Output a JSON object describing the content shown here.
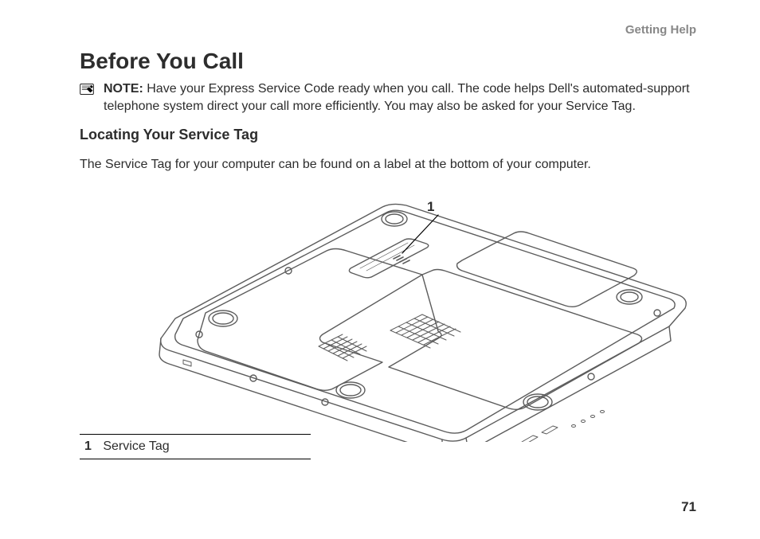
{
  "header": {
    "section": "Getting Help"
  },
  "title": "Before You Call",
  "note": {
    "label": "NOTE:",
    "text": "Have your Express Service Code ready when you call. The code helps Dell's automated-support telephone system direct your call more efficiently. You may also be asked for your Service Tag."
  },
  "subheading": "Locating Your Service Tag",
  "intro": "The Service Tag for your computer can be found on a label at the bottom of your computer.",
  "figure": {
    "callout_number": "1",
    "legend_items": [
      {
        "num": "1",
        "label": "Service Tag"
      }
    ]
  },
  "page_number": "71"
}
